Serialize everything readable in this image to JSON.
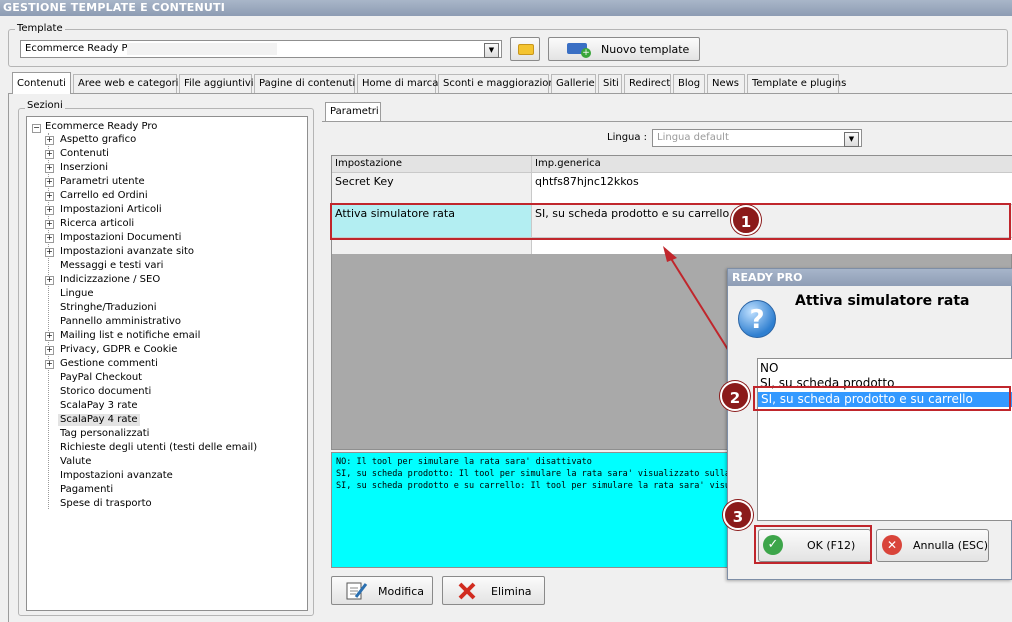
{
  "window": {
    "title": "GESTIONE TEMPLATE E CONTENUTI"
  },
  "template": {
    "group_label": "Template",
    "selected": "Ecommerce Ready Pro",
    "new_button": "Nuovo template"
  },
  "tabs": [
    "Contenuti",
    "Aree web e categorie",
    "File aggiuntivi",
    "Pagine di contenuti",
    "Home di marca",
    "Sconti e maggiorazioni",
    "Gallerie",
    "Siti",
    "Redirect",
    "Blog",
    "News",
    "Template e plugins"
  ],
  "sections": {
    "label": "Sezioni",
    "root": "Ecommerce Ready Pro",
    "items": [
      "Aspetto grafico",
      "Contenuti",
      "Inserzioni",
      "Parametri utente",
      "Carrello ed Ordini",
      "Impostazioni Articoli",
      "Ricerca articoli",
      "Impostazioni Documenti",
      "Impostazioni avanzate sito",
      "Messaggi e testi vari",
      "Indicizzazione / SEO",
      "Lingue",
      "Stringhe/Traduzioni",
      "Pannello amministrativo",
      "Mailing list e notifiche email",
      "Privacy, GDPR e Cookie",
      "Gestione commenti",
      "PayPal Checkout",
      "Storico documenti",
      "ScalaPay 3 rate",
      "ScalaPay 4 rate",
      "Tag personalizzati",
      "Richieste degli utenti (testi delle email)",
      "Valute",
      "Impostazioni avanzate",
      "Pagamenti",
      "Spese di trasporto"
    ],
    "expandable": [
      true,
      true,
      true,
      true,
      true,
      true,
      true,
      true,
      true,
      false,
      true,
      false,
      false,
      false,
      true,
      true,
      true,
      false,
      false,
      false,
      false,
      false,
      false,
      false,
      false,
      false,
      false
    ],
    "selected_index": 20
  },
  "params": {
    "tab": "Parametri",
    "lingua_label": "Lingua :",
    "lingua_value": "Lingua default",
    "col_setting": "Impostazione",
    "col_value": "Imp.generica",
    "rows": [
      {
        "setting": "Secret Key",
        "value": "qhtfs87hjnc12kkos"
      },
      {
        "setting": "Attiva simulatore rata",
        "value": "SI, su scheda prodotto e su carrello"
      }
    ],
    "description": [
      "NO: Il tool per simulare la rata sara' disattivato",
      "SI, su scheda prodotto: Il tool per simulare la rata sara' visualizzato sulla scheda prodotto",
      "SI, su scheda prodotto e su carrello: Il tool per simulare la rata sara' visualizzato sulla scheda"
    ],
    "modify_button": "Modifica",
    "delete_button": "Elimina"
  },
  "dialog": {
    "title": "READY PRO",
    "heading": "Attiva simulatore rata",
    "options": [
      "NO",
      "SI, su scheda prodotto",
      "SI, su scheda prodotto e su carrello"
    ],
    "selected_index": 2,
    "ok_button": "OK (F12)",
    "cancel_button": "Annulla (ESC)"
  },
  "badges": [
    "1",
    "2",
    "3"
  ],
  "colors": {
    "accent_red": "#c0262c",
    "badge": "#8b1a1a",
    "selection": "#3399ff",
    "description_bg": "#00ffff",
    "highlight_cell": "#b3eef2"
  }
}
